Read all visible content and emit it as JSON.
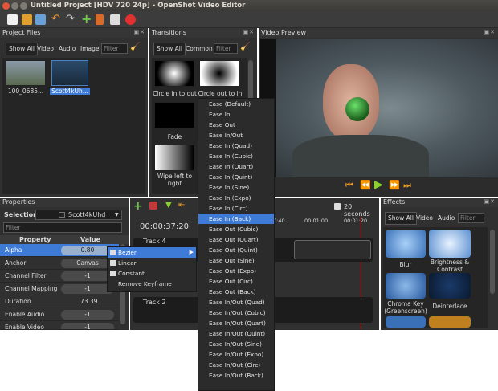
{
  "window": {
    "title": "Untitled Project [HDV 720 24p] - OpenShot Video Editor"
  },
  "toolbar": {
    "icons": [
      "new-project-icon",
      "open-project-icon",
      "save-project-icon",
      "undo-icon",
      "redo-icon",
      "add-files-icon",
      "choose-profile-icon",
      "fullscreen-icon",
      "export-icon"
    ]
  },
  "project_files": {
    "title": "Project Files",
    "tabs": [
      "Show All",
      "Video",
      "Audio",
      "Image"
    ],
    "filter_placeholder": "Filter",
    "files": [
      {
        "name": "100_0685..."
      },
      {
        "name": "Scott4kUh..."
      }
    ]
  },
  "transitions": {
    "title": "Transitions",
    "tabs": [
      "Show All",
      "Common"
    ],
    "filter_placeholder": "Filter",
    "items": [
      "Circle in to out",
      "Circle out to in",
      "Fade",
      "Wipe left to right"
    ]
  },
  "video_preview": {
    "title": "Video Preview"
  },
  "properties": {
    "title": "Properties",
    "selection_label": "Selection:",
    "selection_value": "Scott4kUhd",
    "filter_placeholder": "Filter",
    "col_property": "Property",
    "col_value": "Value",
    "rows": [
      {
        "name": "Alpha",
        "value": "0.80"
      },
      {
        "name": "Anchor",
        "value": "Canvas"
      },
      {
        "name": "Channel Filter",
        "value": "-1"
      },
      {
        "name": "Channel Mapping",
        "value": "-1"
      },
      {
        "name": "Duration",
        "value": "73.39"
      },
      {
        "name": "Enable Audio",
        "value": "-1"
      },
      {
        "name": "Enable Video",
        "value": "-1"
      }
    ]
  },
  "timeline": {
    "timecode": "00:00:37:20",
    "zoom_label": "20 seconds",
    "ruler": [
      "0:40",
      "00:01:00",
      "00:01:20"
    ],
    "tracks": [
      "Track 4",
      "Track 2"
    ]
  },
  "effects": {
    "title": "Effects",
    "tabs": [
      "Show All",
      "Video",
      "Audio"
    ],
    "filter_placeholder": "Filter",
    "items": [
      "Blur",
      "Brightness & Contrast",
      "Chroma Key (Greenscreen)",
      "Deinterlace"
    ]
  },
  "context_menu": {
    "items": [
      "Bezier",
      "Linear",
      "Constant",
      "Remove Keyframe"
    ]
  },
  "bezier_submenu": {
    "selected_index": 11,
    "items": [
      "Ease (Default)",
      "Ease In",
      "Ease Out",
      "Ease In/Out",
      "Ease In (Quad)",
      "Ease In (Cubic)",
      "Ease In (Quart)",
      "Ease In (Quint)",
      "Ease In (Sine)",
      "Ease In (Expo)",
      "Ease In (Circ)",
      "Ease In (Back)",
      "Ease Out (Cubic)",
      "Ease Out (Quart)",
      "Ease Out (Quint)",
      "Ease Out (Sine)",
      "Ease Out (Expo)",
      "Ease Out (Circ)",
      "Ease Out (Back)",
      "Ease In/Out (Quad)",
      "Ease In/Out (Cubic)",
      "Ease In/Out (Quart)",
      "Ease In/Out (Quint)",
      "Ease In/Out (Sine)",
      "Ease In/Out (Expo)",
      "Ease In/Out (Circ)",
      "Ease In/Out (Back)"
    ]
  }
}
